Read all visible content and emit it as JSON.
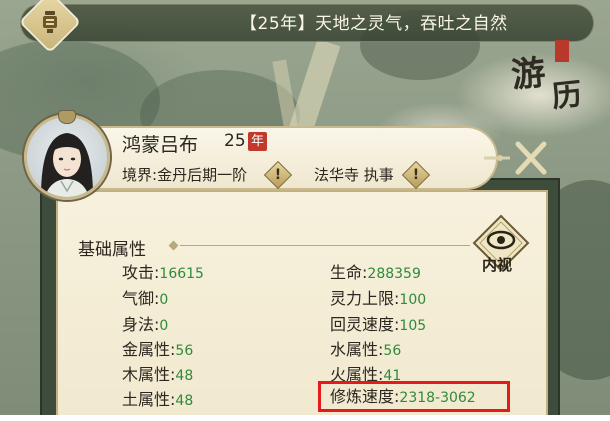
{
  "banner": {
    "text": "【25年】天地之灵气，吞吐之自然"
  },
  "map_label": {
    "char1": "游",
    "char2": "历"
  },
  "character": {
    "name": "鸿蒙吕布",
    "age": "25",
    "year_badge": "年",
    "realm_label": "境界",
    "realm_value": "金丹后期一阶",
    "sect": "法华寺",
    "position": "执事",
    "warn_mark": "!"
  },
  "inner_view": {
    "label": "内视"
  },
  "basic_attributes": {
    "title": "基础属性",
    "left": [
      {
        "label": "攻击",
        "value": "16615"
      },
      {
        "label": "气御",
        "value": "0"
      },
      {
        "label": "身法",
        "value": "0"
      },
      {
        "label": "金属性",
        "value": "56"
      },
      {
        "label": "木属性",
        "value": "48"
      },
      {
        "label": "土属性",
        "value": "48"
      }
    ],
    "right": [
      {
        "label": "生命",
        "value": "288359"
      },
      {
        "label": "灵力上限",
        "value": "100"
      },
      {
        "label": "回灵速度",
        "value": "105"
      },
      {
        "label": "水属性",
        "value": "56"
      },
      {
        "label": "火属性",
        "value": "41"
      },
      {
        "label": "修炼速度",
        "value": "2318-3062"
      }
    ],
    "separator": ":"
  },
  "colors": {
    "value_green": "#2f8a3a",
    "highlight_red": "#e51a1a",
    "year_badge_red": "#c0392b"
  }
}
